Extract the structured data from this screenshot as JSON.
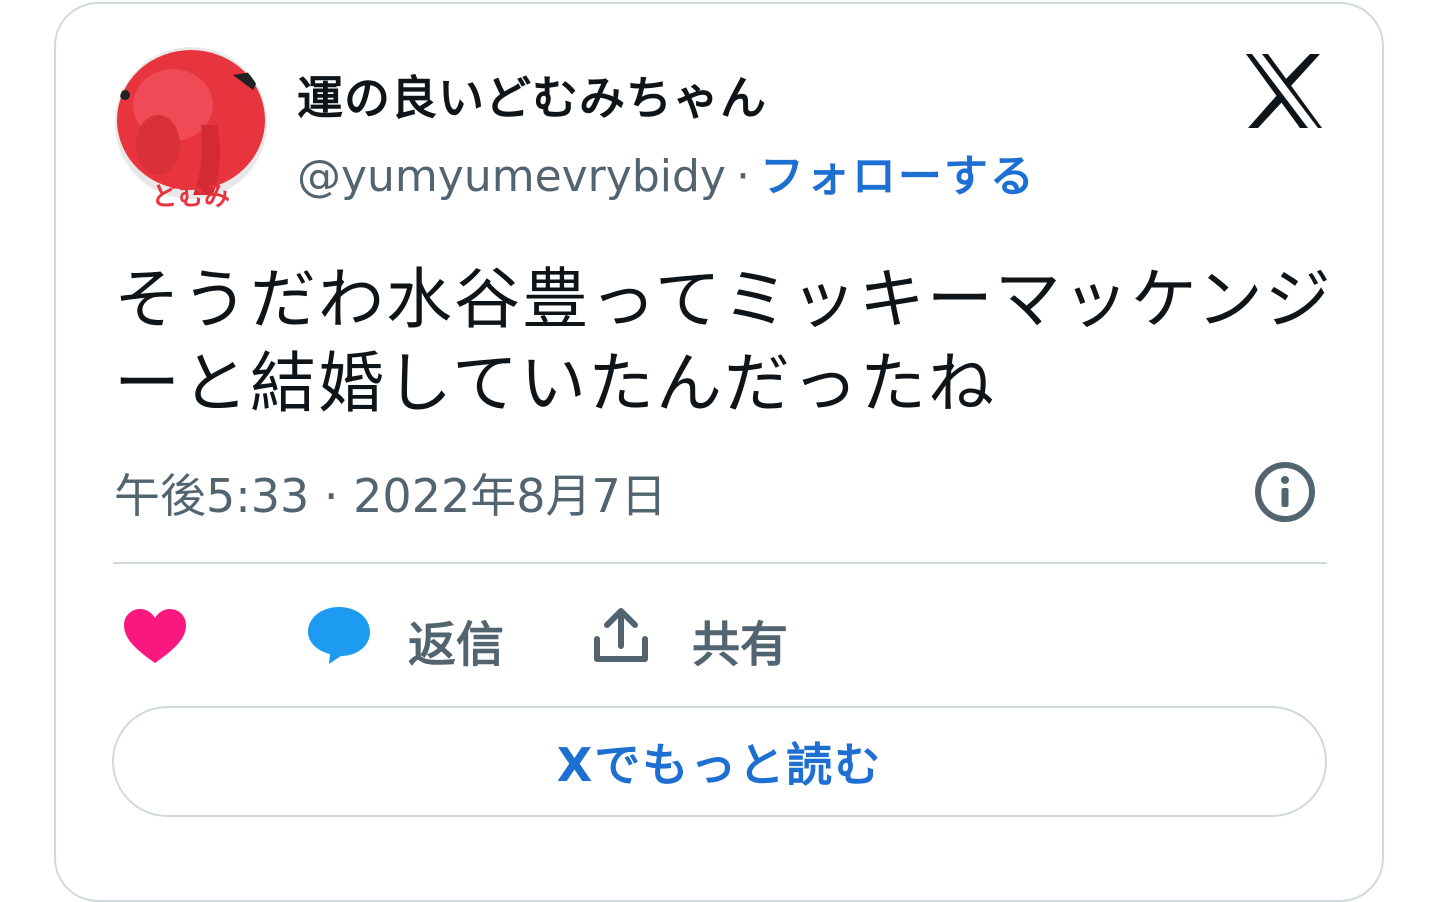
{
  "author": {
    "display_name": "運の良いどむみちゃん",
    "handle": "@yumyumevrybidy",
    "separator": "·",
    "follow_label": "フォローする",
    "avatar_caption": "どむみ"
  },
  "tweet": {
    "text": "そうだわ水谷豊ってミッキーマッケンジーと結婚していたんだったね",
    "timestamp": "午後5:33 · 2022年8月7日"
  },
  "actions": {
    "reply_label": "返信",
    "share_label": "共有"
  },
  "read_more_label": "Xでもっと読む",
  "icons": {
    "logo": "x-logo-icon",
    "info": "info-icon",
    "like": "heart-icon",
    "reply": "speech-bubble-icon",
    "share": "share-upload-icon"
  },
  "colors": {
    "accent": "#1d6fd1",
    "like": "#f91880",
    "reply": "#1d9bf0",
    "secondary_text": "#536471",
    "border": "#cfd9de"
  }
}
